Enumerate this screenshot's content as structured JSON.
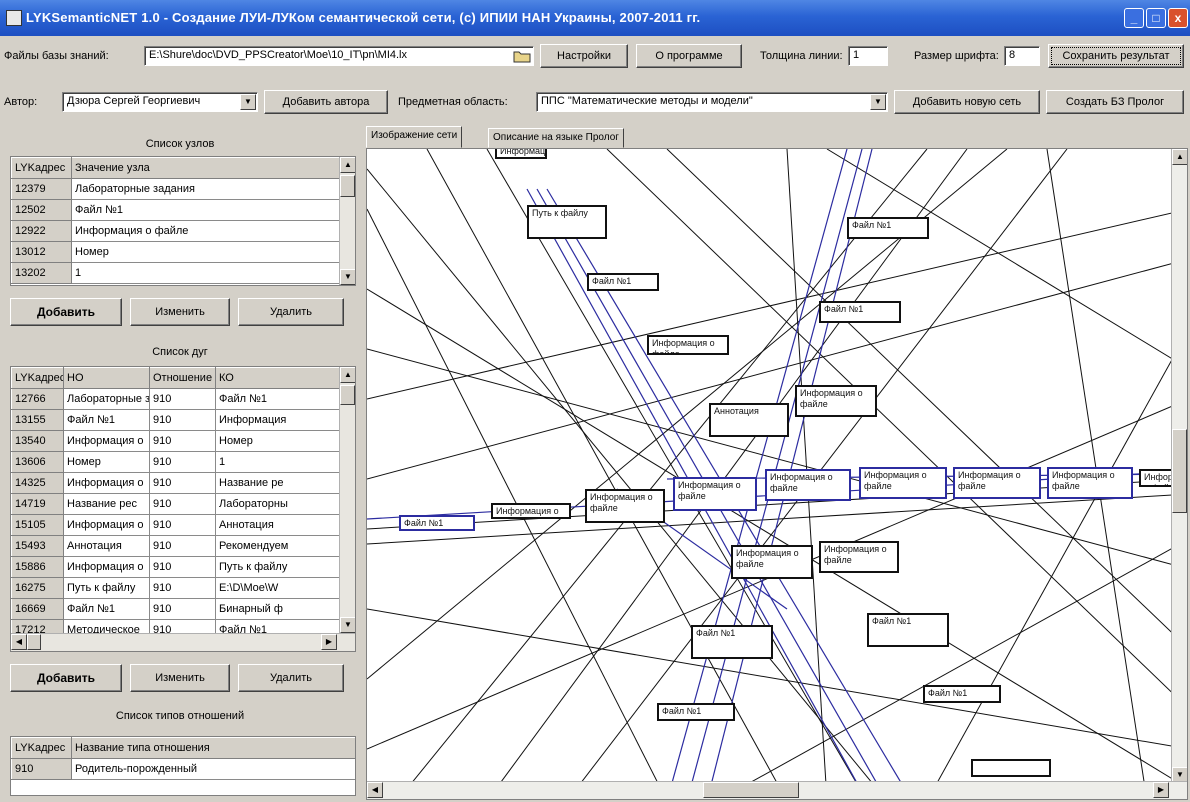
{
  "window": {
    "title": "LYKSemanticNET 1.0 - Создание ЛУИ-ЛУКом семантической сети, (c) ИПИИ НАН Украины, 2007-2011 гг.",
    "min_glyph": "_",
    "max_glyph": "□",
    "close_glyph": "x"
  },
  "toolbar1": {
    "kb_file_label": "Файлы базы знаний:",
    "kb_file_value": "E:\\Shure\\doc\\DVD_PPSCreator\\Moe\\10_IT\\pn\\MI4.lx",
    "settings_button": "Настройки",
    "about_button": "О программе",
    "line_thickness_label": "Толщина линии:",
    "line_thickness_value": "1",
    "font_size_label": "Размер шрифта:",
    "font_size_value": "8",
    "save_button": "Сохранить результат"
  },
  "toolbar2": {
    "author_label": "Автор:",
    "author_value": "Дзюра Сергей Георгиевич",
    "add_author_button": "Добавить автора",
    "subject_label": "Предметная область:",
    "subject_value": "ППС \"Математические методы и модели\"",
    "add_network_button": "Добавить новую сеть",
    "create_prolog_button": "Создать БЗ Пролог"
  },
  "nodes_panel": {
    "title": "Список узлов",
    "columns": [
      "LYKадрес",
      "Значение узла"
    ],
    "rows": [
      [
        "12379",
        "Лабораторные задания"
      ],
      [
        "12502",
        "Файл №1"
      ],
      [
        "12922",
        "Информация о файле"
      ],
      [
        "13012",
        "Номер"
      ],
      [
        "13202",
        "1"
      ]
    ],
    "add_button": "Добавить",
    "edit_button": "Изменить",
    "delete_button": "Удалить"
  },
  "arcs_panel": {
    "title": "Список дуг",
    "columns": [
      "LYKадрес",
      "НО",
      "Отношение",
      "КО"
    ],
    "rows": [
      [
        "12766",
        "Лабораторные з",
        "910",
        "Файл №1"
      ],
      [
        "13155",
        "Файл №1",
        "910",
        "Информация"
      ],
      [
        "13540",
        "Информация о",
        "910",
        "Номер"
      ],
      [
        "13606",
        "Номер",
        "910",
        "1"
      ],
      [
        "14325",
        "Информация о",
        "910",
        "Название ре"
      ],
      [
        "14719",
        "Название рес",
        "910",
        "Лабораторны"
      ],
      [
        "15105",
        "Информация о",
        "910",
        "Аннотация"
      ],
      [
        "15493",
        "Аннотация",
        "910",
        "Рекомендуем"
      ],
      [
        "15886",
        "Информация о",
        "910",
        "Путь к файлу"
      ],
      [
        "16275",
        "Путь к файлу",
        "910",
        "E:\\D\\Moe\\W"
      ],
      [
        "16669",
        "Файл №1",
        "910",
        "Бинарный ф"
      ],
      [
        "17212",
        "Методическое",
        "910",
        "Файл №1"
      ]
    ],
    "add_button": "Добавить",
    "edit_button": "Изменить",
    "delete_button": "Удалить"
  },
  "reltypes_panel": {
    "title": "Список типов отношений",
    "columns": [
      "LYKадрес",
      "Название типа отношения"
    ],
    "rows": [
      [
        "910",
        "Родитель-порожденный"
      ]
    ]
  },
  "tabs": {
    "network_view": "Изображение сети",
    "prolog_description": "Описание на языке Пролог"
  },
  "graph_nodes": [
    {
      "id": "n1",
      "text": "Информация о файле"
    },
    {
      "id": "n2",
      "text": "Путь к файлу"
    },
    {
      "id": "n3",
      "text": "Файл №1"
    },
    {
      "id": "n4",
      "text": "Файл №1"
    },
    {
      "id": "n5",
      "text": "Файл №1"
    },
    {
      "id": "n6",
      "text": "Информация о файле"
    },
    {
      "id": "n7",
      "text": "Информация о файле"
    },
    {
      "id": "n8",
      "text": "Аннотация"
    },
    {
      "id": "n9",
      "text": "Файл №1"
    },
    {
      "id": "n10",
      "text": "Информация о файле"
    },
    {
      "id": "n11",
      "text": "Информация о файле"
    },
    {
      "id": "n12",
      "text": "Информация о файле"
    },
    {
      "id": "n13",
      "text": "Информация о файле"
    },
    {
      "id": "n14",
      "text": "Информация о файле"
    },
    {
      "id": "n15",
      "text": "Информация о файле"
    },
    {
      "id": "n16",
      "text": "Информация о файле"
    },
    {
      "id": "n17",
      "text": "Информация о файле"
    },
    {
      "id": "n18",
      "text": "Информация о файле"
    },
    {
      "id": "n19",
      "text": "Информация о файле"
    },
    {
      "id": "n20",
      "text": "Файл №1"
    },
    {
      "id": "n21",
      "text": "Файл №1"
    },
    {
      "id": "n22",
      "text": "Файл №1"
    },
    {
      "id": "n23",
      "text": "Файл №1"
    }
  ],
  "colors": {
    "title_bar": "#2a63d4",
    "window_face": "#d4d0c8",
    "graph_line": "#111111",
    "graph_line_blue": "#2c2ca0"
  }
}
